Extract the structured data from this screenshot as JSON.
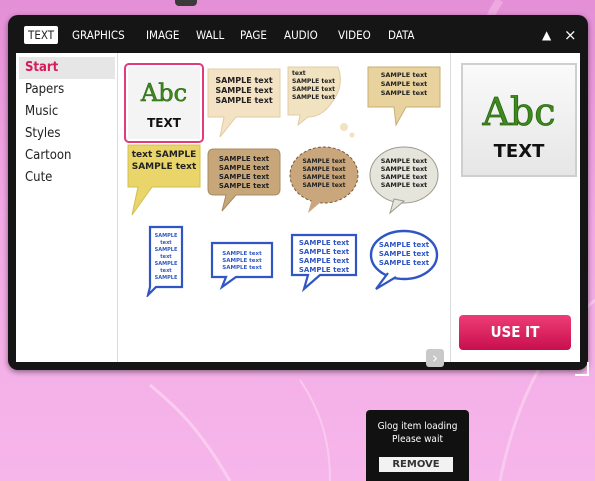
{
  "tabs": [
    "TEXT",
    "GRAPHICS",
    "IMAGE",
    "WALL",
    "PAGE",
    "AUDIO",
    "VIDEO",
    "DATA"
  ],
  "active_tab": "TEXT",
  "window_controls": {
    "collapse": "▲",
    "close": "×"
  },
  "categories": [
    "Start",
    "Papers",
    "Music",
    "Styles",
    "Cartoon",
    "Cute"
  ],
  "active_category": "Start",
  "thumb_main": {
    "abc": "Abc",
    "text": "TEXT"
  },
  "sample_text": "SAMPLE text",
  "sample_text_caps": "SAMPLE",
  "sample_text_word": "text",
  "cut_text": "text SAMPLE",
  "preview": {
    "abc": "Abc",
    "text": "TEXT"
  },
  "use_button": "USE IT",
  "next_icon": "›",
  "loading": {
    "line1": "Glog item loading",
    "line2": "Please wait",
    "remove": "REMOVE"
  },
  "colors": {
    "accent": "#d81b5a",
    "button": "#e0286a",
    "panel": "#151515",
    "abc_green": "#3f8a1f"
  }
}
